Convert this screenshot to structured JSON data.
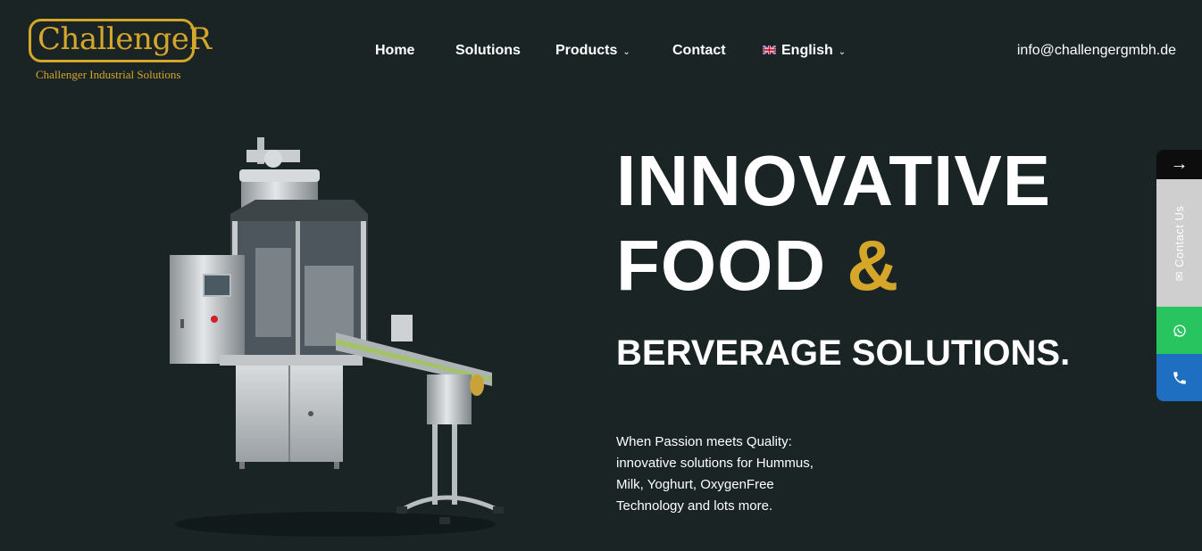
{
  "brand": {
    "logo_word": "ChallengeR",
    "logo_subtitle": "Challenger Industrial Solutions",
    "accent_color": "#d4a62a"
  },
  "nav": {
    "items": [
      {
        "label": "Home",
        "dropdown": false
      },
      {
        "label": "Solutions",
        "dropdown": false
      },
      {
        "label": "Products",
        "dropdown": true
      },
      {
        "label": "Contact",
        "dropdown": false
      },
      {
        "label": "English",
        "dropdown": true,
        "icon": "uk-flag-icon"
      }
    ],
    "email": "info@challengergmbh.de"
  },
  "hero": {
    "line1": "INNOVATIVE",
    "line2_word": "FOOD",
    "line2_amp": "&",
    "line3": "BERVERAGE SOLUTIONS.",
    "tagline": "When Passion meets Quality: innovative solutions for Hummus, Milk, Yoghurt, OxygenFree Technology and lots more."
  },
  "side_widget": {
    "toggle_icon": "arrow-right-icon",
    "contact_label": "Contact Us",
    "contact_icon": "envelope-icon",
    "whatsapp_icon": "whatsapp-icon",
    "phone_icon": "phone-icon",
    "colors": {
      "toggle": "#0d0d0d",
      "contact": "#cfcfcf",
      "whatsapp": "#27c45f",
      "phone": "#1e6fc2"
    }
  }
}
